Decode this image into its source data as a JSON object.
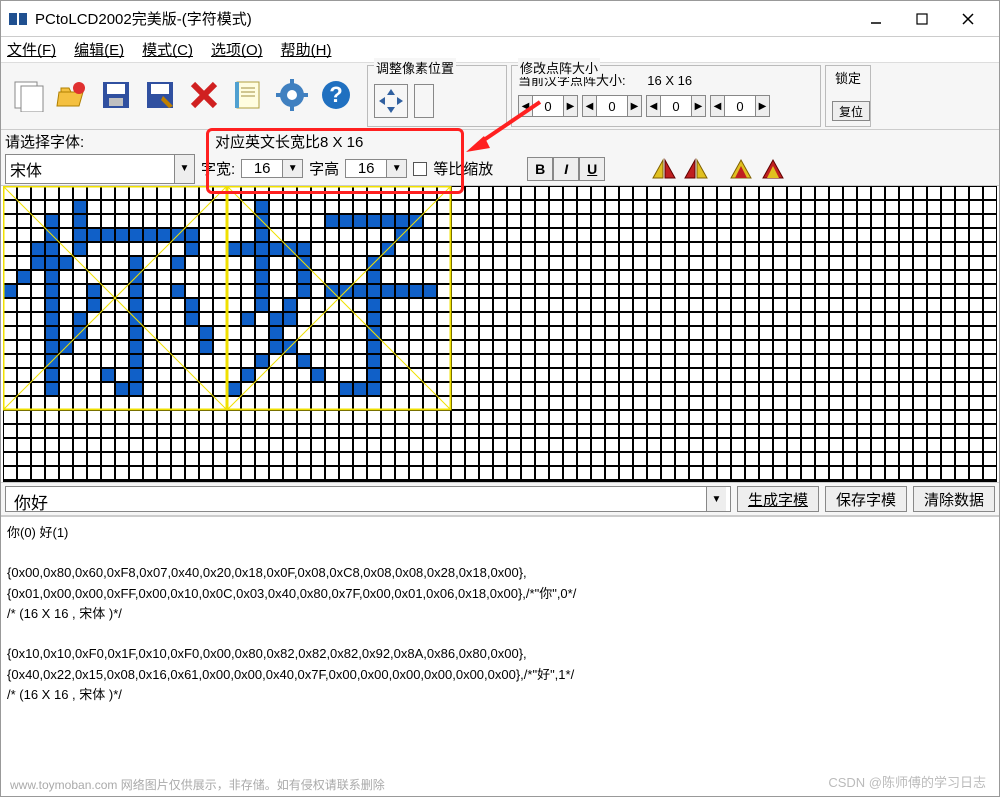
{
  "window": {
    "title": "PCtoLCD2002完美版-(字符模式)"
  },
  "menu": {
    "file": "文件(F)",
    "edit": "编辑(E)",
    "mode": "模式(C)",
    "options": "选项(O)",
    "help": "帮助(H)"
  },
  "panels": {
    "adjust_pixel": "调整像素位置",
    "matrix_size": "修改点阵大小",
    "current_hanzi": "当前汉字点阵大小:",
    "current_value": "16 X 16",
    "lock": "锁定",
    "reset": "复位",
    "spin_a": "0",
    "spin_b": "0",
    "spin_c": "0",
    "spin_d": "0"
  },
  "labels": {
    "select_font": "请选择字体:",
    "english_ratio": "对应英文长宽比8 X 16",
    "font_width": "字宽:",
    "font_height": "字高",
    "equal_scale": "等比缩放"
  },
  "font": {
    "family": "宋体",
    "width": "16",
    "height": "16"
  },
  "biu": {
    "b": "B",
    "i": "I",
    "u": "U"
  },
  "input": {
    "text": "你好"
  },
  "buttons": {
    "generate": "生成字模",
    "save": "保存字模",
    "clear": "清除数据"
  },
  "output": {
    "line1": "你(0) 好(1)",
    "line2": "{0x00,0x80,0x60,0xF8,0x07,0x40,0x20,0x18,0x0F,0x08,0xC8,0x08,0x08,0x28,0x18,0x00},",
    "line3": "{0x01,0x00,0x00,0xFF,0x00,0x10,0x0C,0x03,0x40,0x80,0x7F,0x00,0x01,0x06,0x18,0x00},/*\"你\",0*/",
    "line4": "/* (16 X 16 , 宋体 )*/",
    "line5": "{0x10,0x10,0xF0,0x1F,0x10,0xF0,0x00,0x80,0x82,0x82,0x82,0x92,0x8A,0x86,0x80,0x00},",
    "line6": "{0x40,0x22,0x15,0x08,0x16,0x61,0x00,0x00,0x40,0x7F,0x00,0x00,0x00,0x00,0x00,0x00},/*\"好\",1*/",
    "line7": "/* (16 X 16 , 宋体 )*/"
  },
  "glyph_ni": [
    [
      0,
      0,
      0,
      0,
      0,
      0,
      0,
      0,
      0,
      0,
      0,
      0,
      0,
      0,
      0,
      0
    ],
    [
      0,
      0,
      0,
      0,
      0,
      1,
      0,
      0,
      0,
      0,
      0,
      0,
      0,
      0,
      0,
      0
    ],
    [
      0,
      0,
      0,
      1,
      0,
      1,
      0,
      0,
      0,
      0,
      0,
      0,
      0,
      0,
      0,
      0
    ],
    [
      0,
      0,
      0,
      1,
      0,
      1,
      1,
      1,
      1,
      1,
      1,
      1,
      1,
      1,
      0,
      0
    ],
    [
      0,
      0,
      1,
      1,
      0,
      1,
      0,
      0,
      0,
      0,
      0,
      0,
      0,
      1,
      0,
      0
    ],
    [
      0,
      0,
      1,
      1,
      1,
      0,
      0,
      0,
      0,
      1,
      0,
      0,
      1,
      0,
      0,
      0
    ],
    [
      0,
      1,
      0,
      1,
      0,
      0,
      0,
      0,
      0,
      1,
      0,
      0,
      0,
      0,
      0,
      0
    ],
    [
      1,
      0,
      0,
      1,
      0,
      0,
      1,
      0,
      0,
      1,
      0,
      0,
      1,
      0,
      0,
      0
    ],
    [
      0,
      0,
      0,
      1,
      0,
      0,
      1,
      0,
      0,
      1,
      0,
      0,
      0,
      1,
      0,
      0
    ],
    [
      0,
      0,
      0,
      1,
      0,
      1,
      0,
      0,
      0,
      1,
      0,
      0,
      0,
      1,
      0,
      0
    ],
    [
      0,
      0,
      0,
      1,
      0,
      1,
      0,
      0,
      0,
      1,
      0,
      0,
      0,
      0,
      1,
      0
    ],
    [
      0,
      0,
      0,
      1,
      1,
      0,
      0,
      0,
      0,
      1,
      0,
      0,
      0,
      0,
      1,
      0
    ],
    [
      0,
      0,
      0,
      1,
      0,
      0,
      0,
      0,
      0,
      1,
      0,
      0,
      0,
      0,
      0,
      0
    ],
    [
      0,
      0,
      0,
      1,
      0,
      0,
      0,
      1,
      0,
      1,
      0,
      0,
      0,
      0,
      0,
      0
    ],
    [
      0,
      0,
      0,
      1,
      0,
      0,
      0,
      0,
      1,
      1,
      0,
      0,
      0,
      0,
      0,
      0
    ],
    [
      0,
      0,
      0,
      0,
      0,
      0,
      0,
      0,
      0,
      0,
      0,
      0,
      0,
      0,
      0,
      0
    ]
  ],
  "glyph_hao": [
    [
      0,
      0,
      0,
      0,
      0,
      0,
      0,
      0,
      0,
      0,
      0,
      0,
      0,
      0,
      0,
      0
    ],
    [
      0,
      0,
      1,
      0,
      0,
      0,
      0,
      0,
      0,
      0,
      0,
      0,
      0,
      0,
      0,
      0
    ],
    [
      0,
      0,
      1,
      0,
      0,
      0,
      0,
      1,
      1,
      1,
      1,
      1,
      1,
      1,
      0,
      0
    ],
    [
      0,
      0,
      1,
      0,
      0,
      0,
      0,
      0,
      0,
      0,
      0,
      0,
      1,
      0,
      0,
      0
    ],
    [
      1,
      1,
      1,
      1,
      1,
      1,
      0,
      0,
      0,
      0,
      0,
      1,
      0,
      0,
      0,
      0
    ],
    [
      0,
      0,
      1,
      0,
      0,
      1,
      0,
      0,
      0,
      0,
      1,
      0,
      0,
      0,
      0,
      0
    ],
    [
      0,
      0,
      1,
      0,
      0,
      1,
      0,
      0,
      0,
      0,
      1,
      0,
      0,
      0,
      0,
      0
    ],
    [
      0,
      0,
      1,
      0,
      0,
      1,
      0,
      1,
      1,
      1,
      1,
      1,
      1,
      1,
      1,
      0
    ],
    [
      0,
      0,
      1,
      0,
      1,
      0,
      0,
      0,
      0,
      0,
      1,
      0,
      0,
      0,
      0,
      0
    ],
    [
      0,
      1,
      0,
      1,
      1,
      0,
      0,
      0,
      0,
      0,
      1,
      0,
      0,
      0,
      0,
      0
    ],
    [
      0,
      0,
      0,
      1,
      0,
      0,
      0,
      0,
      0,
      0,
      1,
      0,
      0,
      0,
      0,
      0
    ],
    [
      0,
      0,
      0,
      1,
      1,
      0,
      0,
      0,
      0,
      0,
      1,
      0,
      0,
      0,
      0,
      0
    ],
    [
      0,
      0,
      1,
      0,
      0,
      1,
      0,
      0,
      0,
      0,
      1,
      0,
      0,
      0,
      0,
      0
    ],
    [
      0,
      1,
      0,
      0,
      0,
      0,
      1,
      0,
      0,
      0,
      1,
      0,
      0,
      0,
      0,
      0
    ],
    [
      1,
      0,
      0,
      0,
      0,
      0,
      0,
      0,
      1,
      1,
      1,
      0,
      0,
      0,
      0,
      0
    ],
    [
      0,
      0,
      0,
      0,
      0,
      0,
      0,
      0,
      0,
      0,
      0,
      0,
      0,
      0,
      0,
      0
    ]
  ],
  "watermark": {
    "csdn": "CSDN @陈师傅的学习日志",
    "bottom": "www.toymoban.com  网络图片仅供展示，非存储。如有侵权请联系删除"
  }
}
